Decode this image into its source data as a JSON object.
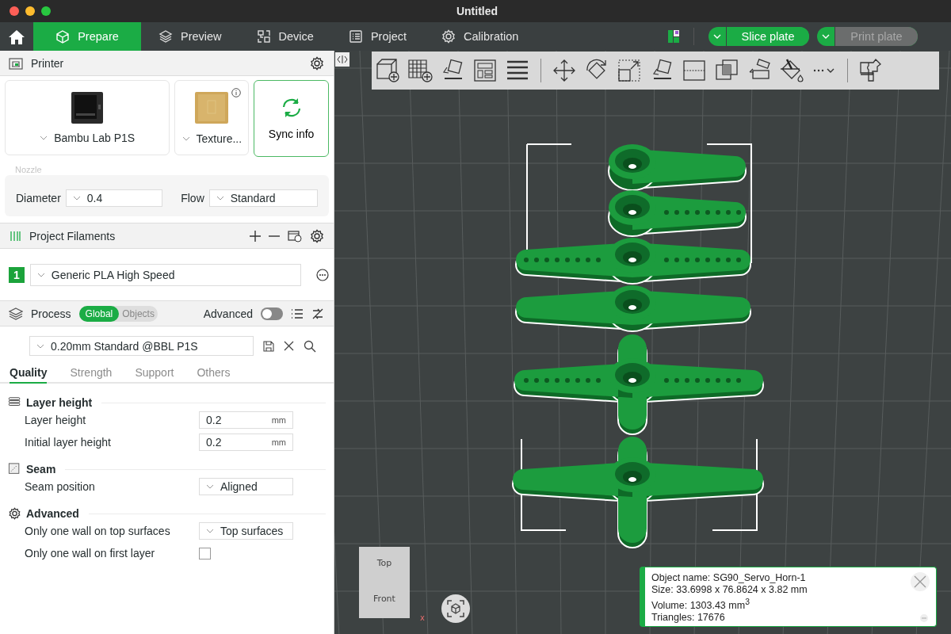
{
  "window": {
    "title": "Untitled"
  },
  "tabs": [
    {
      "label": "Prepare",
      "selected": true
    },
    {
      "label": "Preview",
      "selected": false
    },
    {
      "label": "Device",
      "selected": false
    },
    {
      "label": "Project",
      "selected": false
    },
    {
      "label": "Calibration",
      "selected": false
    }
  ],
  "actions": [
    {
      "label": "Slice plate",
      "disabled": false
    },
    {
      "label": "Print plate",
      "disabled": true
    }
  ],
  "printer": {
    "title": "Printer",
    "model": "Bambu Lab P1S",
    "plate": "Texture...",
    "sync": "Sync info",
    "nozzle_label": "Nozzle",
    "diameter_label": "Diameter",
    "diameter": "0.4",
    "flow_label": "Flow",
    "flow": "Standard"
  },
  "filaments": {
    "title": "Project Filaments",
    "items": [
      {
        "index": "1",
        "name": "Generic PLA High Speed",
        "color": "#1ba33b"
      }
    ]
  },
  "process": {
    "title": "Process",
    "modes": [
      {
        "label": "Global",
        "selected": true
      },
      {
        "label": "Objects",
        "selected": false
      }
    ],
    "advanced_label": "Advanced",
    "advanced": false,
    "preset": "0.20mm Standard @BBL P1S",
    "tabs": [
      {
        "label": "Quality",
        "selected": true
      },
      {
        "label": "Strength",
        "selected": false
      },
      {
        "label": "Support",
        "selected": false
      },
      {
        "label": "Others",
        "selected": false
      }
    ],
    "groups": [
      {
        "title": "Layer height",
        "options": [
          {
            "kind": "number",
            "label": "Layer height",
            "value": "0.2",
            "unit": "mm"
          },
          {
            "kind": "number",
            "label": "Initial layer height",
            "value": "0.2",
            "unit": "mm"
          }
        ]
      },
      {
        "title": "Seam",
        "options": [
          {
            "kind": "select",
            "label": "Seam position",
            "value": "Aligned"
          }
        ]
      },
      {
        "title": "Advanced",
        "options": [
          {
            "kind": "select",
            "label": "Only one wall on top surfaces",
            "value": "Top surfaces"
          },
          {
            "kind": "checkbox",
            "label": "Only one wall on first layer",
            "checked": false
          }
        ]
      }
    ]
  },
  "view_cube": {
    "top": "Top",
    "front": "Front",
    "axis_x": "x"
  },
  "object_info": {
    "lines": [
      "Object name: SG90_Servo_Horn-1",
      "Size: 33.6998 x 76.8624 x 3.82 mm",
      "Volume: 1303.43 mm$^{3}$",
      "Triangles: 17676"
    ]
  }
}
